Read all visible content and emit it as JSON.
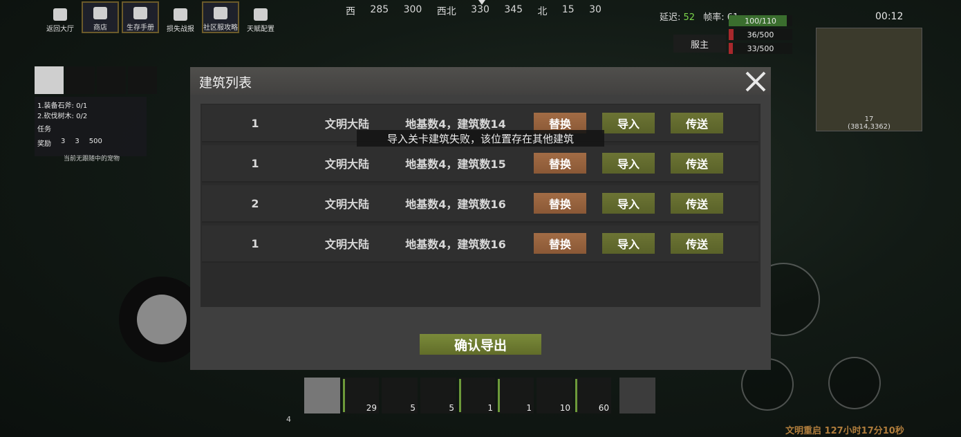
{
  "topbar": {
    "buttons": [
      {
        "label": "返回大厅"
      },
      {
        "label": "商店"
      },
      {
        "label": "生存手册"
      },
      {
        "label": "损失战报"
      },
      {
        "label": "社区服攻略"
      },
      {
        "label": "天赋配置"
      }
    ]
  },
  "compass": {
    "ticks": [
      "西",
      "285",
      "300",
      "西北",
      "330",
      "345",
      "北",
      "15",
      "30"
    ]
  },
  "stats": {
    "latency_label": "延迟:",
    "latency_value": "52",
    "fps_label": "帧率:",
    "fps_value": "61",
    "health": "100/110",
    "hunger": "36/500",
    "thirst": "33/500",
    "health_level": 0.91,
    "hunger_level": 0.072,
    "thirst_level": 0.066,
    "server_label": "服主",
    "clock": "00:12"
  },
  "minimap": {
    "level": "17",
    "coords": "(3814,3362)"
  },
  "quest": {
    "items": [
      "1.装备石斧: 0/1",
      "2.砍伐树木: 0/2"
    ],
    "task_label": "任务",
    "reward_label": "奖励",
    "reward_counts": [
      "3",
      "3",
      "500"
    ],
    "pet_text": "当前无跟随中的宠物"
  },
  "modal": {
    "title": "建筑列表",
    "close_label": "✕",
    "rows": [
      {
        "num": "1",
        "map": "文明大陆",
        "info": "地基数4，建筑数14",
        "replace": "替换",
        "import": "导入",
        "send": "传送"
      },
      {
        "num": "1",
        "map": "文明大陆",
        "info": "地基数4，建筑数15",
        "replace": "替换",
        "import": "导入",
        "send": "传送"
      },
      {
        "num": "2",
        "map": "文明大陆",
        "info": "地基数4，建筑数16",
        "replace": "替换",
        "import": "导入",
        "send": "传送"
      },
      {
        "num": "1",
        "map": "文明大陆",
        "info": "地基数4，建筑数16",
        "replace": "替换",
        "import": "导入",
        "send": "传送"
      }
    ],
    "toast": "导入关卡建筑失败，该位置存在其他建筑",
    "confirm_label": "确认导出"
  },
  "hotbar": {
    "page": "4",
    "slots": [
      {
        "icon": "helmet-icon",
        "count": ""
      },
      {
        "icon": "crossbow-icon",
        "count": "29"
      },
      {
        "icon": "bottle-icon",
        "count": "5"
      },
      {
        "icon": "meat-icon",
        "count": "5"
      },
      {
        "icon": "axe-icon",
        "count": "1"
      },
      {
        "icon": "knife-icon",
        "count": "1"
      },
      {
        "icon": "medkit-icon",
        "count": "10"
      },
      {
        "icon": "crossbow-icon",
        "count": "60"
      },
      {
        "icon": "tools-icon",
        "count": ""
      }
    ]
  },
  "restart_notice": "文明重启 127小时17分10秒"
}
